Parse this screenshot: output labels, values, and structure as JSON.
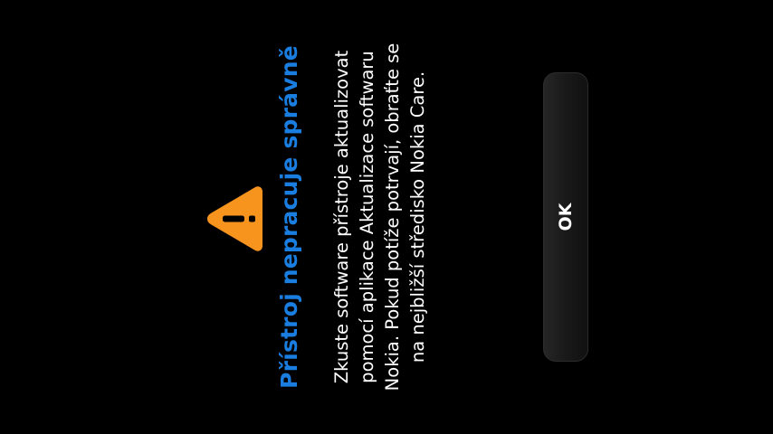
{
  "dialog": {
    "icon": "warning-icon",
    "icon_color": "#f7941d",
    "title": "Přístroj nepracuje správně",
    "title_color": "#1a7ee0",
    "message_lines": [
      "Zkuste software přístroje aktualizovat",
      "pomocí aplikace Aktualizace softwaru",
      "Nokia. Pokud potíže potrvají, obraťte se",
      "na nejbližší středisko Nokia Care."
    ],
    "ok_label": "OK"
  }
}
